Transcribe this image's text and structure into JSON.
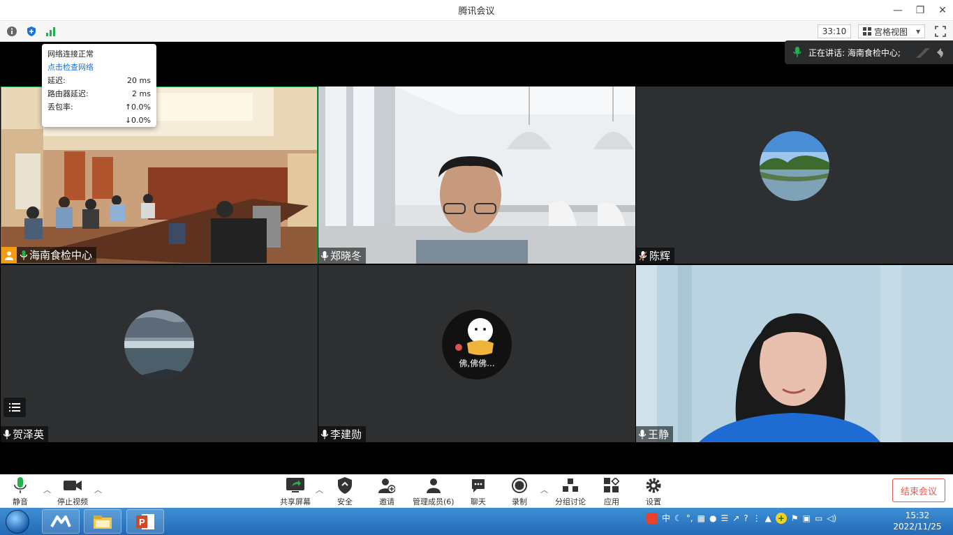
{
  "window": {
    "title": "腾讯会议"
  },
  "infobar": {
    "timer": "33:10",
    "view_label": "宫格视图"
  },
  "network_tooltip": {
    "status": "网络连接正常",
    "link": "点击检查网络",
    "rows": [
      {
        "label": "延迟:",
        "value": "20 ms"
      },
      {
        "label": "路由器延迟:",
        "value": "2 ms"
      },
      {
        "label": "丢包率:",
        "value": "↑0.0%"
      },
      {
        "label": "",
        "value": "↓0.0%"
      }
    ]
  },
  "speaking": {
    "label": "正在讲话: 海南食检中心;"
  },
  "participants": [
    {
      "name": "海南食检中心"
    },
    {
      "name": "郑晓冬"
    },
    {
      "name": "陈辉"
    },
    {
      "name": "贺泽英"
    },
    {
      "name": "李建勋"
    },
    {
      "name": "王静"
    }
  ],
  "avatar_caption": "佛,佛佛...",
  "toolbar": {
    "mute": "静音",
    "stop_video": "停止视频",
    "share": "共享屏幕",
    "security": "安全",
    "invite": "邀请",
    "members": "管理成员(6)",
    "chat": "聊天",
    "record": "录制",
    "breakout": "分组讨论",
    "apps": "应用",
    "settings": "设置",
    "end": "结束会议"
  },
  "taskbar": {
    "ime": "中",
    "time": "15:32",
    "date": "2022/11/25"
  },
  "colors": {
    "accent_green": "#22b14c",
    "end_red": "#e05a4f",
    "host_orange": "#f39c12"
  }
}
